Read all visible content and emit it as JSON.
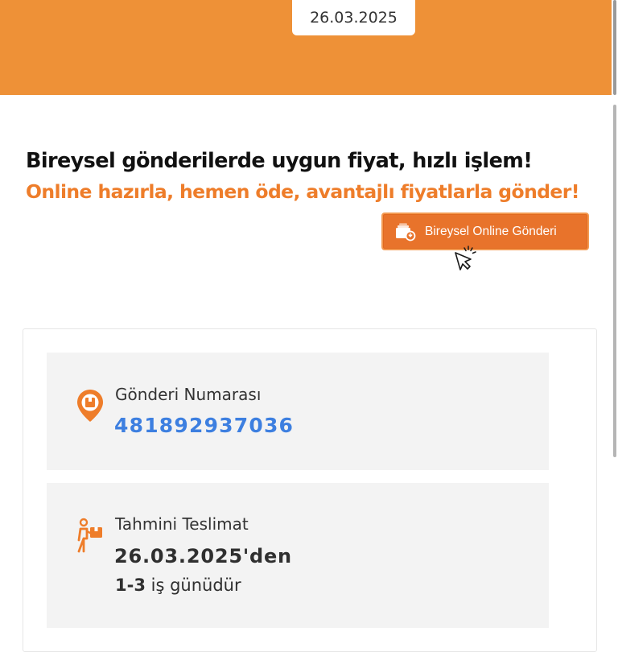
{
  "header": {
    "date": "26.03.2025"
  },
  "promo": {
    "title": "Bireysel gönderilerde uygun fiyat, hızlı işlem!",
    "subtitle": "Online hazırla, hemen öde, avantajlı fiyatlarla gönder!",
    "button_label": "Bireysel Online Gönderi",
    "button_icon": "package-stack-icon",
    "cursor_icon": "click-cursor-icon"
  },
  "shipment": {
    "icon": "package-location-pin-icon",
    "label": "Gönderi Numarası",
    "number": "481892937036"
  },
  "delivery": {
    "icon": "courier-carrying-box-icon",
    "label": "Tahmini Teslimat",
    "date": "26.03.2025'den",
    "range_days": "1-3",
    "range_suffix": " iş günüdür"
  },
  "colors": {
    "brand_orange": "#ee9137",
    "button_orange": "#e8732b",
    "tracking_blue": "#3d7fe0",
    "box_gray": "#f3f3f3"
  }
}
